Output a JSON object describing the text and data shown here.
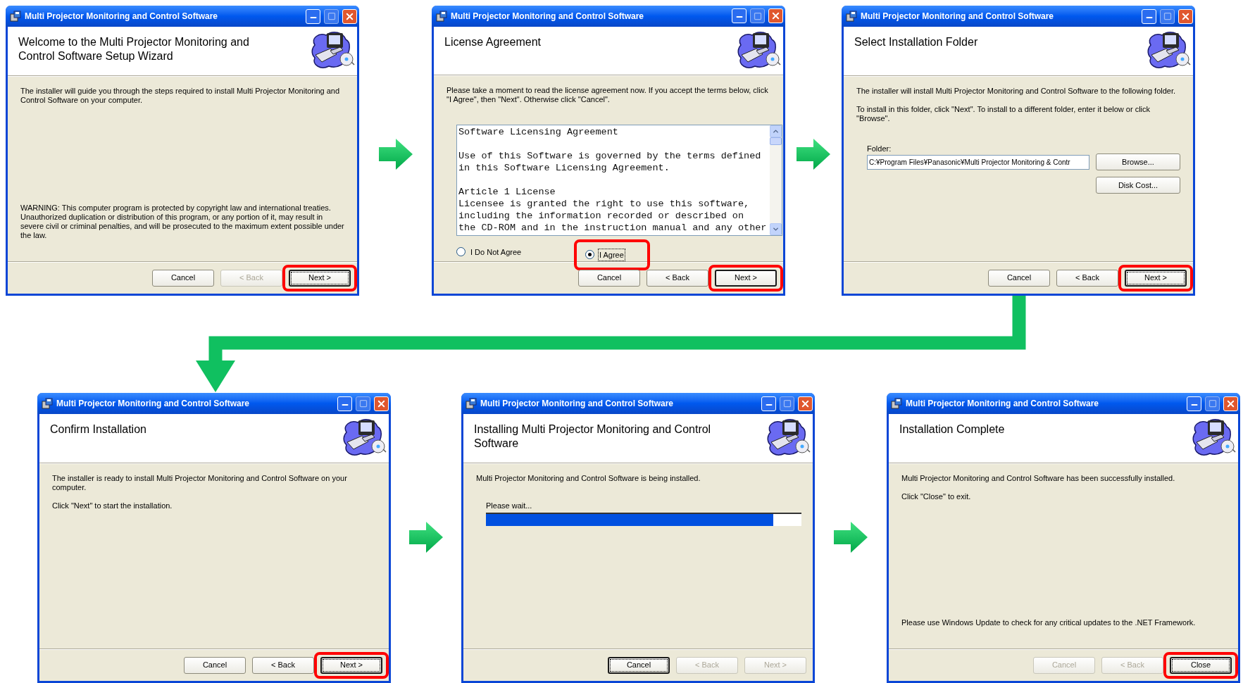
{
  "windows": [
    {
      "title": "Multi Projector Monitoring and Control Software",
      "heading": "Welcome to the Multi Projector Monitoring and Control Software Setup Wizard",
      "body": [
        {
          "kind": "text",
          "text": "The installer will guide you through the steps required to install Multi Projector Monitoring and Control Software on your computer."
        },
        {
          "kind": "bottom_text",
          "text": "WARNING: This computer program is protected by copyright law and international treaties. Unauthorized duplication or distribution of this program, or any portion of it, may result in severe civil or criminal penalties, and will be prosecuted to the maximum extent possible under the law."
        }
      ],
      "buttons": [
        {
          "label": "Cancel",
          "disabled": false,
          "default": false,
          "focused": false,
          "highlighted": false
        },
        {
          "label": "< Back",
          "disabled": true,
          "default": false,
          "focused": false,
          "highlighted": false
        },
        {
          "label": "Next >",
          "disabled": false,
          "default": true,
          "focused": true,
          "highlighted": true
        }
      ]
    },
    {
      "title": "Multi Projector Monitoring and Control Software",
      "heading": "License Agreement",
      "body": [
        {
          "kind": "text",
          "text": "Please take a moment to read the license agreement now. If you accept the terms below, click \"I Agree\", then \"Next\". Otherwise click \"Cancel\"."
        },
        {
          "kind": "license",
          "paragraphs": [
            [
              "Software Licensing Agreement"
            ],
            [
              "Use of this Software is governed by the terms defined",
              "in this Software Licensing Agreement."
            ],
            [
              "Article 1 License",
              "Licensee is granted the right to use this software,",
              "including the information recorded or described on",
              "the CD-ROM and in the instruction manual and any other"
            ]
          ]
        },
        {
          "kind": "radios",
          "options": [
            {
              "label": "I Do Not Agree",
              "selected": false,
              "focused": false,
              "highlighted": false
            },
            {
              "label": "I Agree",
              "selected": true,
              "focused": true,
              "highlighted": true
            }
          ]
        }
      ],
      "buttons": [
        {
          "label": "Cancel",
          "disabled": false,
          "default": false,
          "focused": false,
          "highlighted": false
        },
        {
          "label": "< Back",
          "disabled": false,
          "default": false,
          "focused": false,
          "highlighted": false
        },
        {
          "label": "Next >",
          "disabled": false,
          "default": true,
          "focused": false,
          "highlighted": true
        }
      ]
    },
    {
      "title": "Multi Projector Monitoring and Control Software",
      "heading": "Select Installation Folder",
      "body": [
        {
          "kind": "text",
          "text": "The installer will install Multi Projector Monitoring and Control Software to the following folder."
        },
        {
          "kind": "text",
          "text": "To install in this folder, click \"Next\". To install to a different folder, enter it below or click \"Browse\"."
        },
        {
          "kind": "folder",
          "label": "Folder:",
          "value": "C:¥Program Files¥Panasonic¥Multi Projector Monitoring & Contr",
          "buttons": [
            {
              "label": "Browse...",
              "disabled": false,
              "default": false,
              "focused": false,
              "highlighted": false
            },
            {
              "label": "Disk Cost...",
              "disabled": false,
              "default": false,
              "focused": false,
              "highlighted": false
            }
          ]
        }
      ],
      "buttons": [
        {
          "label": "Cancel",
          "disabled": false,
          "default": false,
          "focused": false,
          "highlighted": false
        },
        {
          "label": "< Back",
          "disabled": false,
          "default": false,
          "focused": false,
          "highlighted": false
        },
        {
          "label": "Next >",
          "disabled": false,
          "default": true,
          "focused": true,
          "highlighted": true
        }
      ]
    },
    {
      "title": "Multi Projector Monitoring and Control Software",
      "heading": "Confirm Installation",
      "body": [
        {
          "kind": "text",
          "text": "The installer is ready to install Multi Projector Monitoring and Control Software on your computer."
        },
        {
          "kind": "text",
          "text": "Click \"Next\" to start the installation."
        }
      ],
      "buttons": [
        {
          "label": "Cancel",
          "disabled": false,
          "default": false,
          "focused": false,
          "highlighted": false
        },
        {
          "label": "< Back",
          "disabled": false,
          "default": false,
          "focused": false,
          "highlighted": false
        },
        {
          "label": "Next >",
          "disabled": false,
          "default": true,
          "focused": true,
          "highlighted": true
        }
      ]
    },
    {
      "title": "Multi Projector Monitoring and Control Software",
      "heading": "Installing Multi Projector Monitoring and Control Software",
      "body": [
        {
          "kind": "text",
          "text": "Multi Projector Monitoring and Control Software is being installed."
        },
        {
          "kind": "progress",
          "label": "Please wait...",
          "level": 0.91
        }
      ],
      "buttons": [
        {
          "label": "Cancel",
          "disabled": false,
          "default": true,
          "focused": true,
          "highlighted": false
        },
        {
          "label": "< Back",
          "disabled": true,
          "default": false,
          "focused": false,
          "highlighted": false
        },
        {
          "label": "Next >",
          "disabled": true,
          "default": false,
          "focused": false,
          "highlighted": false
        }
      ]
    },
    {
      "title": "Multi Projector Monitoring and Control Software",
      "heading": "Installation Complete",
      "body": [
        {
          "kind": "text",
          "text": "Multi Projector Monitoring and Control Software has been successfully installed."
        },
        {
          "kind": "text",
          "text": "Click \"Close\" to exit."
        },
        {
          "kind": "bottom_text",
          "text": "Please use Windows Update to check for any critical updates to the .NET Framework."
        }
      ],
      "buttons": [
        {
          "label": "Cancel",
          "disabled": true,
          "default": false,
          "focused": false,
          "highlighted": false
        },
        {
          "label": "< Back",
          "disabled": true,
          "default": false,
          "focused": false,
          "highlighted": false
        },
        {
          "label": "Close",
          "disabled": false,
          "default": true,
          "focused": true,
          "highlighted": true
        }
      ]
    }
  ]
}
